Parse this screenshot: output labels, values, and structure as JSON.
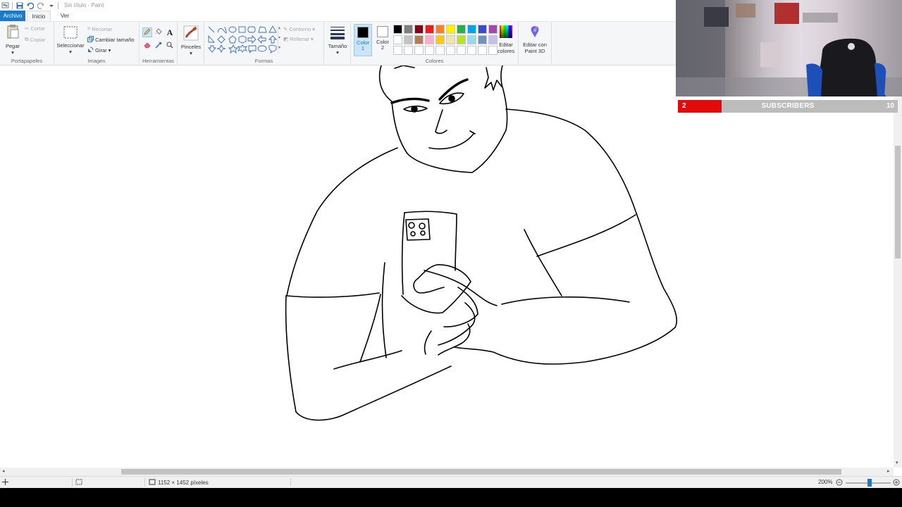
{
  "window": {
    "title": "Sin título - Paint"
  },
  "tabs": {
    "file": "Archivo",
    "home": "Inicio",
    "view": "Ver"
  },
  "ribbon": {
    "clipboard": {
      "label": "Portapapeles",
      "paste": "Pegar",
      "cut": "Cortar",
      "copy": "Copiar"
    },
    "image": {
      "label": "Imagen",
      "select": "Seleccionar",
      "crop": "Recortar",
      "resize": "Cambiar tamaño",
      "rotate": "Girar"
    },
    "tools": {
      "label": "Herramientas"
    },
    "brushes": {
      "label": "Pinceles"
    },
    "shapes": {
      "label": "Formas",
      "outline": "Contorno",
      "fill": "Rellenar"
    },
    "size": {
      "label": "Tamaño"
    },
    "colors": {
      "label": "Colores",
      "color1_line1": "Color",
      "color1_line2": "1",
      "color2_line1": "Color",
      "color2_line2": "2",
      "edit_line1": "Editar",
      "edit_line2": "colores",
      "paint3d_line1": "Editar con",
      "paint3d_line2": "Paint 3D",
      "color1": "#000000",
      "color2": "#ffffff",
      "palette": [
        "#000000",
        "#7f7f7f",
        "#880015",
        "#ed1c24",
        "#ff7f27",
        "#fff200",
        "#22b14c",
        "#00a2e8",
        "#3f48cc",
        "#a349a4",
        "#ffffff",
        "#c3c3c3",
        "#b97a57",
        "#ffaec9",
        "#ffc90e",
        "#efe4b0",
        "#b5e61d",
        "#99d9ea",
        "#7092be",
        "#c8bfe7",
        "#ffffff",
        "#ffffff",
        "#ffffff",
        "#ffffff",
        "#ffffff",
        "#ffffff",
        "#ffffff",
        "#ffffff",
        "#ffffff",
        "#ffffff"
      ]
    }
  },
  "status": {
    "dimensions": "1152 × 1452 píxeles",
    "zoom": "200%"
  },
  "overlay": {
    "subscribers_label": "SUBSCRIBERS",
    "current": "2",
    "goal": "10",
    "progress_fraction": 0.2
  }
}
